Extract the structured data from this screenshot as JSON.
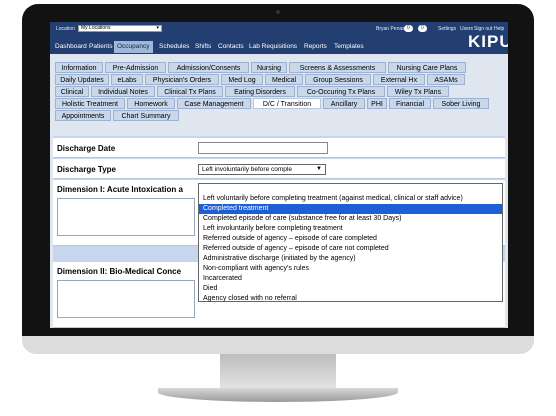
{
  "header": {
    "location_label": "Location",
    "location_value": "My Locations",
    "user_name": "Bryan Penasi",
    "badge_a": "0",
    "badge_b": "0",
    "links": [
      "Settings",
      "Users",
      "Sign out",
      "Help"
    ],
    "logo": "KIPU"
  },
  "nav": {
    "items": [
      "Dashboard",
      "Patients",
      "Occupancy",
      "Schedules",
      "Shifts",
      "Contacts",
      "Lab Requisitions",
      "Reports",
      "Templates"
    ],
    "active": "Occupancy"
  },
  "tabs": {
    "rows": [
      [
        "Information",
        "Pre-Admission",
        "Admission/Consents",
        "Nursing",
        "Screens & Assessments",
        "Nursing Care Plans"
      ],
      [
        "Daily Updates",
        "eLabs",
        "Physician's Orders",
        "Med Log",
        "Medical",
        "Group Sessions",
        "External Hx",
        "ASAMs"
      ],
      [
        "Clinical",
        "Individual Notes",
        "Clinical Tx Plans",
        "Eating Disorders",
        "Co-Occuring Tx Plans",
        "Wiley Tx Plans"
      ],
      [
        "Holistic Treatment",
        "Homework",
        "Case Management",
        "D/C / Transition",
        "Ancillary",
        "PHI",
        "Financial",
        "Sober Living"
      ],
      [
        "Appointments",
        "Chart Summary"
      ]
    ],
    "active": "D/C / Transition"
  },
  "form": {
    "discharge_date_label": "Discharge Date",
    "discharge_type_label": "Discharge Type",
    "discharge_type_value": "Left involuntarily before comple",
    "dimension1_label": "Dimension I: Acute Intoxication a",
    "dimension2_label": "Dimension II: Bio-Medical Conce"
  },
  "dropdown": {
    "options": [
      "",
      "Left voluntarily before completing treatment (against medical, clinical or staff advice)",
      "Completed treatment",
      "Completed episode of care (substance free for at least 30 Days)",
      "Left involuntarily before completing treatment",
      "Referred outside of agency – episode of care completed",
      "Referred outside of agency – episode of care not completed",
      "Administrative discharge (initiated by the agency)",
      "Non-compliant with agency's rules",
      "Incarcerated",
      "Died",
      "Agency closed with no referral"
    ],
    "highlighted": "Completed treatment"
  },
  "colors": {
    "header_bg": "#233f72",
    "tab_bg": "#c9d7ea",
    "selection": "#1e5fd6"
  }
}
